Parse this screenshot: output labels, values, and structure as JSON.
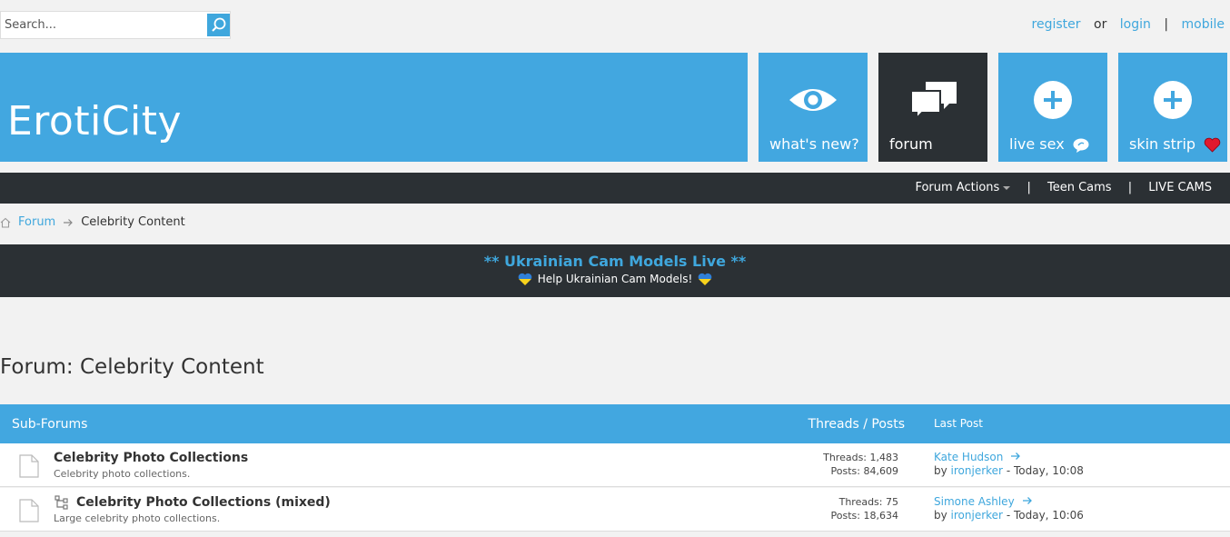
{
  "search": {
    "placeholder": "Search..."
  },
  "auth": {
    "register": "register",
    "or": "or",
    "login": "login",
    "sep": "|",
    "mobile": "mobile"
  },
  "brand": {
    "logo": "ErotiCity"
  },
  "tiles": [
    {
      "label": "what's new?",
      "icon": "eye-icon"
    },
    {
      "label": "forum",
      "icon": "chat-bubbles-icon"
    },
    {
      "label": "live sex",
      "icon": "plus-circle-icon",
      "extra_icon": "speech-bubble-icon"
    },
    {
      "label": "skin strip",
      "icon": "plus-circle-icon",
      "extra_icon": "heart-icon"
    }
  ],
  "nav": {
    "forum_actions": "Forum Actions",
    "teen_cams": "Teen Cams",
    "live_cams": "LIVE CAMS",
    "sep": "|"
  },
  "breadcrumb": {
    "forum": "Forum",
    "current": "Celebrity Content"
  },
  "banner": {
    "title": "** Ukrainian Cam Models Live **",
    "subtitle": "Help Ukrainian Cam Models!"
  },
  "page": {
    "title": "Forum: Celebrity Content"
  },
  "table": {
    "col_subforums": "Sub-Forums",
    "col_threads_posts": "Threads / Posts",
    "col_last_post": "Last Post",
    "rows": [
      {
        "title": "Celebrity Photo Collections",
        "desc": "Celebrity photo collections.",
        "threads": "Threads: 1,483",
        "posts": "Posts: 84,609",
        "last_title": "Kate Hudson",
        "by": "by",
        "last_user": "ironjerker",
        "last_time": "- Today, 10:08"
      },
      {
        "title": "Celebrity Photo Collections (mixed)",
        "desc": "Large celebrity photo collections.",
        "threads": "Threads: 75",
        "posts": "Posts: 18,634",
        "last_title": "Simone Ashley",
        "by": "by",
        "last_user": "ironjerker",
        "last_time": "- Today, 10:06"
      }
    ]
  },
  "colors": {
    "accent": "#42a7e0",
    "dark": "#2b3034",
    "link": "#3fa7dd"
  }
}
